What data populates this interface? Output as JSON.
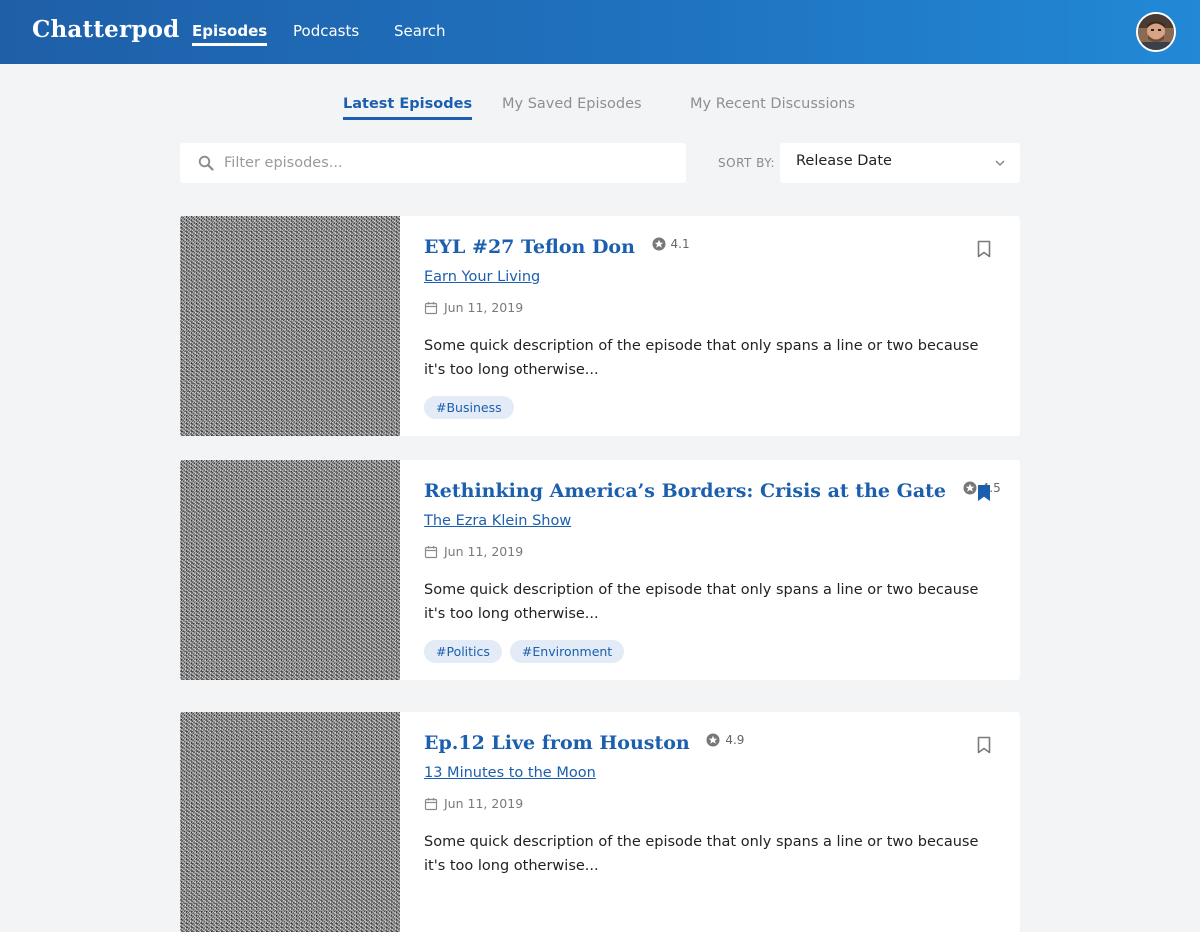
{
  "app": {
    "logo": "Chatterpod",
    "nav": [
      {
        "label": "Episodes",
        "active": true
      },
      {
        "label": "Podcasts",
        "active": false
      },
      {
        "label": "Search",
        "active": false
      }
    ]
  },
  "tabs": [
    {
      "label": "Latest Episodes",
      "active": true
    },
    {
      "label": "My Saved Episodes",
      "active": false
    },
    {
      "label": "My Recent Discussions",
      "active": false
    }
  ],
  "filter": {
    "placeholder": "Filter episodes...",
    "value": ""
  },
  "sort": {
    "label": "SORT BY:",
    "selected": "Release Date"
  },
  "episodes": [
    {
      "title": "EYL #27 Teflon Don",
      "rating": "4.1",
      "podcast": "Earn Your Living",
      "date": "Jun 11, 2019",
      "description": "Some quick description of the episode that only spans a line or two because it's too long otherwise...",
      "tags": [
        "#Business"
      ],
      "bookmarked": false
    },
    {
      "title": "Rethinking America’s Borders: Crisis at the Gate",
      "rating": "4.5",
      "podcast": "The Ezra Klein Show",
      "date": "Jun 11, 2019",
      "description": "Some quick description of the episode that only spans a line or two because it's too long otherwise...",
      "tags": [
        "#Politics",
        "#Environment"
      ],
      "bookmarked": true
    },
    {
      "title": "Ep.12 Live from Houston",
      "rating": "4.9",
      "podcast": "13 Minutes to the Moon",
      "date": "Jun 11, 2019",
      "description": "Some quick description of the episode that only spans a line or two because it's too long otherwise...",
      "tags": [],
      "bookmarked": false
    }
  ],
  "colors": {
    "accent": "#1b5fae",
    "header_gradient_start": "#1f5fa8",
    "header_gradient_end": "#2289d6",
    "tag_bg": "#e2ebf6",
    "page_bg": "#f3f4f6"
  }
}
